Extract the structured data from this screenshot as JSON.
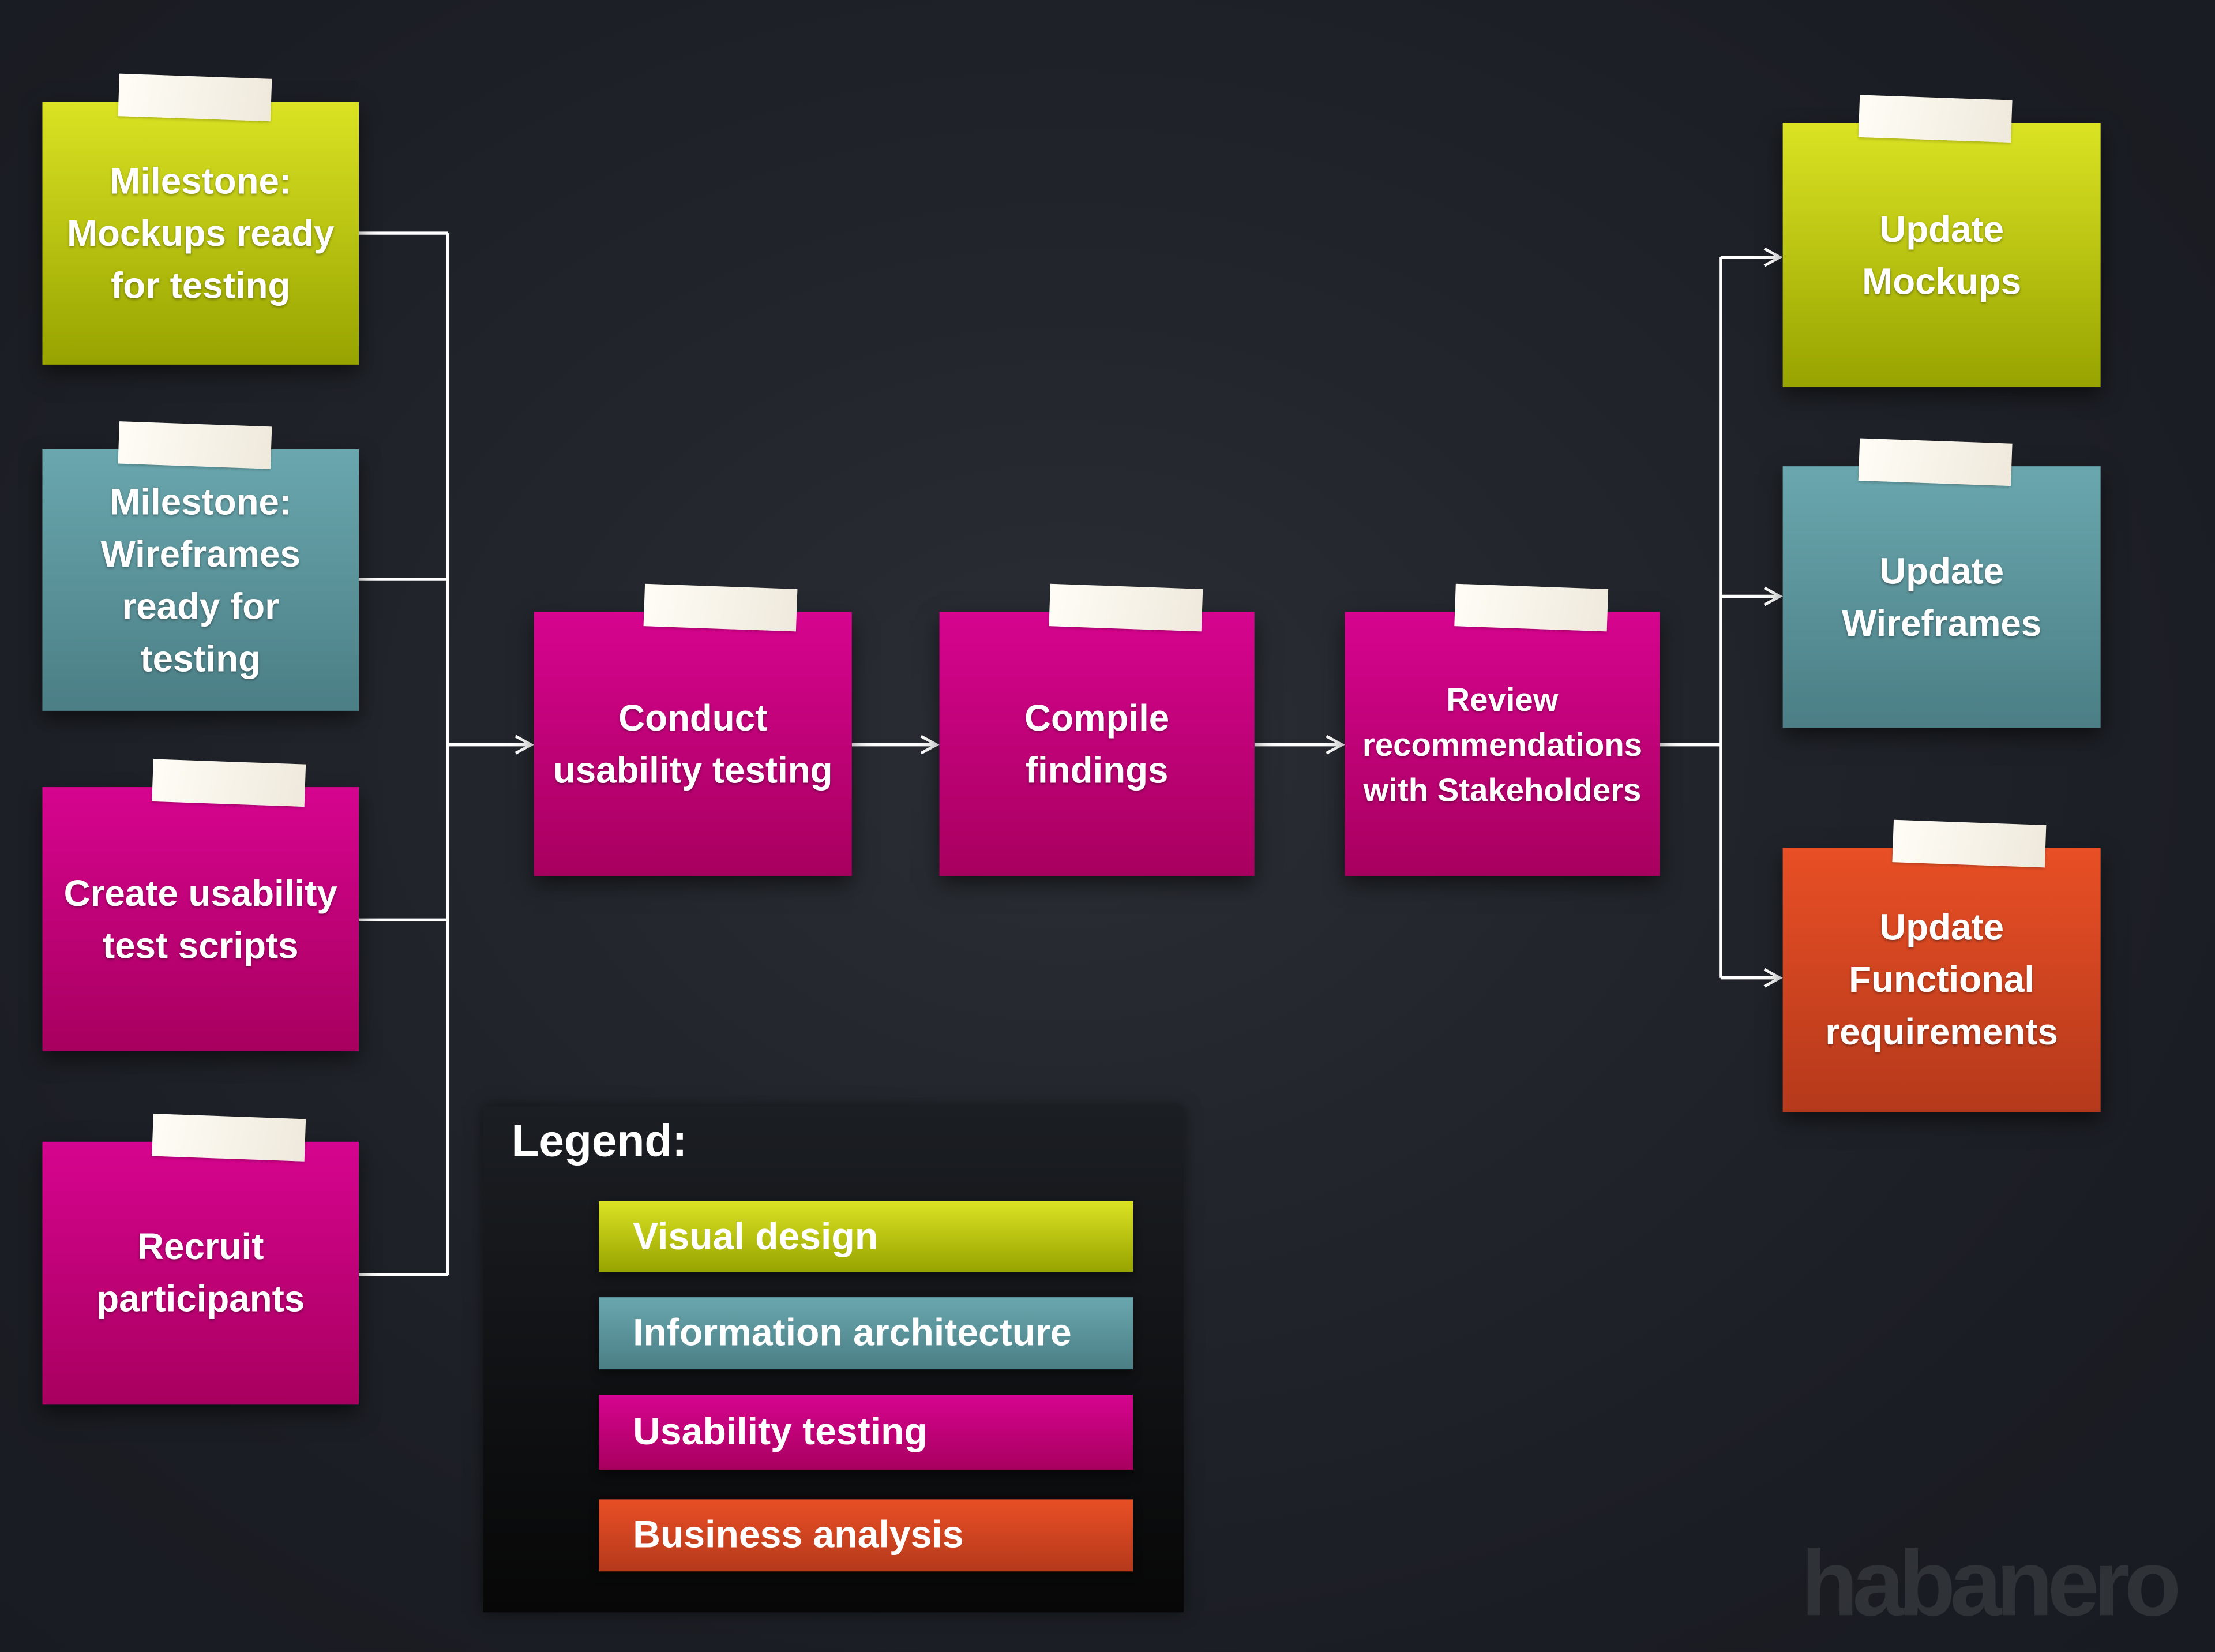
{
  "colors": {
    "visual_design": "#c8d01c",
    "information_architecture": "#5c949b",
    "usability_testing": "#c40080",
    "business_analysis": "#d84522",
    "connector": "#ffffff",
    "background": "#1b1e24"
  },
  "inputs": [
    {
      "label": "Milestone:\nMockups ready\nfor testing",
      "category": "visual_design"
    },
    {
      "label": "Milestone:\nWireframes\nready for\ntesting",
      "category": "information_architecture"
    },
    {
      "label": "Create usability\ntest scripts",
      "category": "usability_testing"
    },
    {
      "label": "Recruit\nparticipants",
      "category": "usability_testing"
    }
  ],
  "process": [
    {
      "label": "Conduct\nusability testing",
      "category": "usability_testing"
    },
    {
      "label": "Compile\nfindings",
      "category": "usability_testing"
    },
    {
      "label": "Review\nrecommendations\nwith Stakeholders",
      "category": "usability_testing"
    }
  ],
  "outputs": [
    {
      "label": "Update\nMockups",
      "category": "visual_design"
    },
    {
      "label": "Update\nWireframes",
      "category": "information_architecture"
    },
    {
      "label": "Update\nFunctional\nrequirements",
      "category": "business_analysis"
    }
  ],
  "legend": {
    "title": "Legend:",
    "items": [
      {
        "label": "Visual design",
        "category": "visual_design"
      },
      {
        "label": "Information architecture",
        "category": "information_architecture"
      },
      {
        "label": "Usability testing",
        "category": "usability_testing"
      },
      {
        "label": "Business analysis",
        "category": "business_analysis"
      }
    ]
  },
  "logo": {
    "text": "habanero"
  }
}
